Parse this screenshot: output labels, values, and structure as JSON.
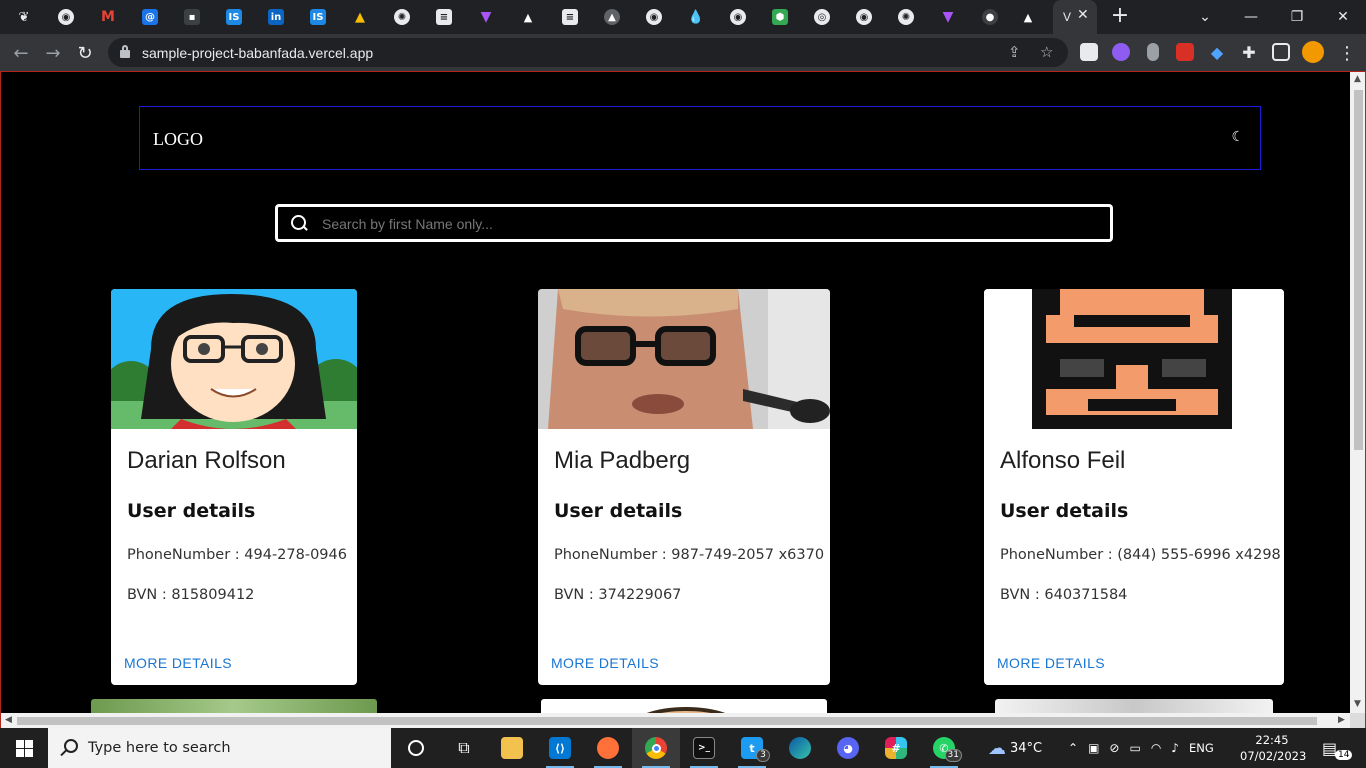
{
  "browser": {
    "active_tab_title": "V",
    "tabs": [
      {
        "icon": "generic-tab-icon",
        "color": "#5f6368"
      },
      {
        "icon": "globe-icon",
        "color": "#5f6368"
      },
      {
        "icon": "gmail-icon",
        "color": "#ea4335"
      },
      {
        "icon": "at-icon",
        "color": "#1a73e8"
      },
      {
        "icon": "generic-tab-icon",
        "color": "#3c4043"
      },
      {
        "icon": "is-icon",
        "color": "#1e88e5"
      },
      {
        "icon": "linkedin-icon",
        "color": "#0a66c2"
      },
      {
        "icon": "is-icon",
        "color": "#1e88e5"
      },
      {
        "icon": "drive-icon",
        "color": "#34a853"
      },
      {
        "icon": "seal-icon",
        "color": "#9aa0a6"
      },
      {
        "icon": "doc-icon",
        "color": "#e8eaed"
      },
      {
        "icon": "vite-icon",
        "color": "#a855f7"
      },
      {
        "icon": "triangle-icon",
        "color": "#ffffff"
      },
      {
        "icon": "doc-icon",
        "color": "#e8eaed"
      },
      {
        "icon": "globe-icon",
        "color": "#5f6368"
      },
      {
        "icon": "triangle-icon",
        "color": "#5f6368"
      },
      {
        "icon": "drop-icon",
        "color": "#1a73e8"
      },
      {
        "icon": "globe-icon",
        "color": "#5f6368"
      },
      {
        "icon": "hex-icon",
        "color": "#34a853"
      },
      {
        "icon": "globe-icon",
        "color": "#5f6368"
      },
      {
        "icon": "github-icon",
        "color": "#9aa0a6"
      }
    ],
    "url": "sample-project-babanfada.vercel.app"
  },
  "page": {
    "logo": "LOGO",
    "theme_toggle": "☾",
    "search_placeholder": "Search by first Name only...",
    "cards": [
      {
        "name": "Darian Rolfson",
        "section_title": "User details",
        "phone": "PhoneNumber : 494-278-0946",
        "bvn": "BVN : 815809412",
        "link": "MORE DETAILS"
      },
      {
        "name": "Mia Padberg",
        "section_title": "User details",
        "phone": "PhoneNumber : 987-749-2057 x6370",
        "bvn": "BVN : 374229067",
        "link": "MORE DETAILS"
      },
      {
        "name": "Alfonso Feil",
        "section_title": "User details",
        "phone": "PhoneNumber : (844) 555-6996 x4298",
        "bvn": "BVN : 640371584",
        "link": "MORE DETAILS"
      }
    ]
  },
  "taskbar": {
    "search_text": "Type here to search",
    "twitter_badge": "3",
    "whatsapp_badge": "31",
    "weather": "34°C",
    "language": "ENG",
    "time": "22:45",
    "date": "07/02/2023",
    "notifications": "14"
  },
  "colors": {
    "navbar_border": "#1c1cd6",
    "link": "#1976d2",
    "page_bg": "#000000"
  }
}
